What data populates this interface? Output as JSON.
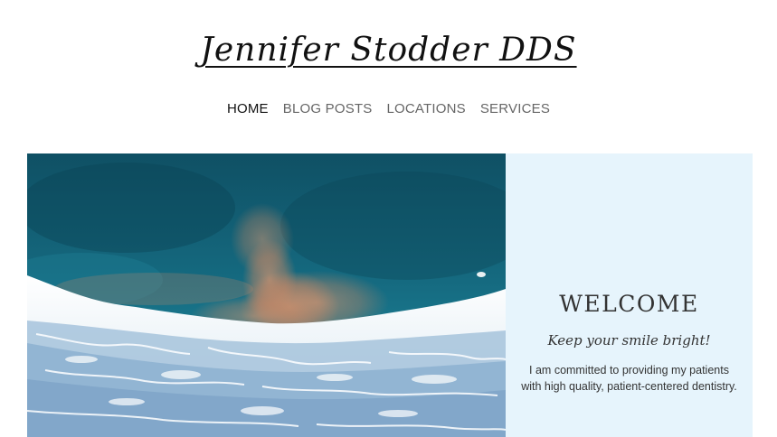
{
  "site": {
    "title": "Jennifer Stodder DDS"
  },
  "nav": {
    "items": [
      {
        "label": "HOME",
        "active": true
      },
      {
        "label": "BLOG POSTS",
        "active": false
      },
      {
        "label": "LOCATIONS",
        "active": false
      },
      {
        "label": "SERVICES",
        "active": false
      }
    ]
  },
  "hero": {
    "image": "aerial-ocean-waves-beach",
    "welcome": {
      "heading": "WELCOME",
      "tagline": "Keep your smile bright!",
      "text": "I am committed to providing my patients with high quality, patient-centered dentistry."
    }
  },
  "colors": {
    "panel_bg": "#e6f4fc",
    "nav_active": "#111111",
    "nav_inactive": "#666666"
  }
}
